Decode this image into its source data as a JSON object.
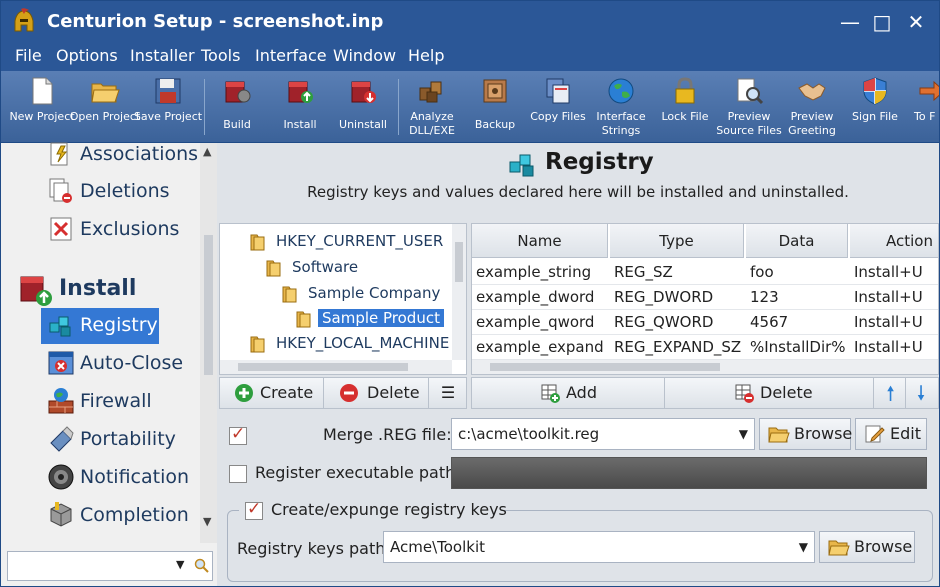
{
  "window": {
    "title": "Centurion Setup - screenshot.inp",
    "minimize_glyph": "—",
    "maximize_glyph": "□",
    "close_glyph": "✕"
  },
  "menu": [
    "File",
    "Options",
    "Installer",
    "Tools",
    "Interface",
    "Window",
    "Help"
  ],
  "toolbar": {
    "new_project": "New Project",
    "open_project": "Open Project",
    "save_project": "Save Project",
    "build": "Build",
    "install": "Install",
    "uninstall": "Uninstall",
    "analyze": "Analyze DLL/EXE",
    "backup": "Backup",
    "copy_files": "Copy Files",
    "interface_strings": "Interface Strings",
    "lock_file": "Lock File",
    "preview_source": "Preview Source Files",
    "preview_greeting": "Preview Greeting",
    "sign_file": "Sign File",
    "to_file": "To F"
  },
  "sidebar": {
    "items_top": [
      "Associations",
      "Deletions",
      "Exclusions"
    ],
    "group": "Install",
    "items_install": [
      "Registry",
      "Auto-Close",
      "Firewall",
      "Portability",
      "Notification",
      "Completion"
    ],
    "selected": "Registry"
  },
  "page": {
    "title": "Registry",
    "description": "Registry keys and values declared here will be installed and uninstalled."
  },
  "tree": {
    "nodes": [
      "HKEY_CURRENT_USER",
      "Software",
      "Sample Company",
      "Sample Product",
      "HKEY_LOCAL_MACHINE"
    ]
  },
  "grid": {
    "columns": [
      "Name",
      "Type",
      "Data",
      "Action"
    ],
    "rows": [
      [
        "example_string",
        "REG_SZ",
        "foo",
        "Install+U"
      ],
      [
        "example_dword",
        "REG_DWORD",
        "123",
        "Install+U"
      ],
      [
        "example_qword",
        "REG_QWORD",
        "4567",
        "Install+U"
      ],
      [
        "example_expand",
        "REG_EXPAND_SZ",
        "%InstallDir%",
        "Install+U"
      ]
    ]
  },
  "tree_buttons": {
    "create": "Create",
    "delete": "Delete",
    "menu_glyph": "☰"
  },
  "grid_buttons": {
    "add": "Add",
    "delete": "Delete",
    "up_glyph": "🠕",
    "down_glyph": "🠗"
  },
  "merge": {
    "label": "Merge .REG file:",
    "value": "c:\\acme\\toolkit.reg",
    "browse": "Browse",
    "edit": "Edit",
    "checked": true
  },
  "register_exe": {
    "label": "Register executable path:",
    "checked": false
  },
  "expunge": {
    "label": "Create/expunge registry keys",
    "checked": true
  },
  "keys_path": {
    "label": "Registry keys path:",
    "value": "Acme\\Toolkit",
    "browse": "Browse"
  },
  "colors": {
    "titlebar": "#2b5797",
    "selection": "#3478d4",
    "accent_red": "#c0392b"
  }
}
